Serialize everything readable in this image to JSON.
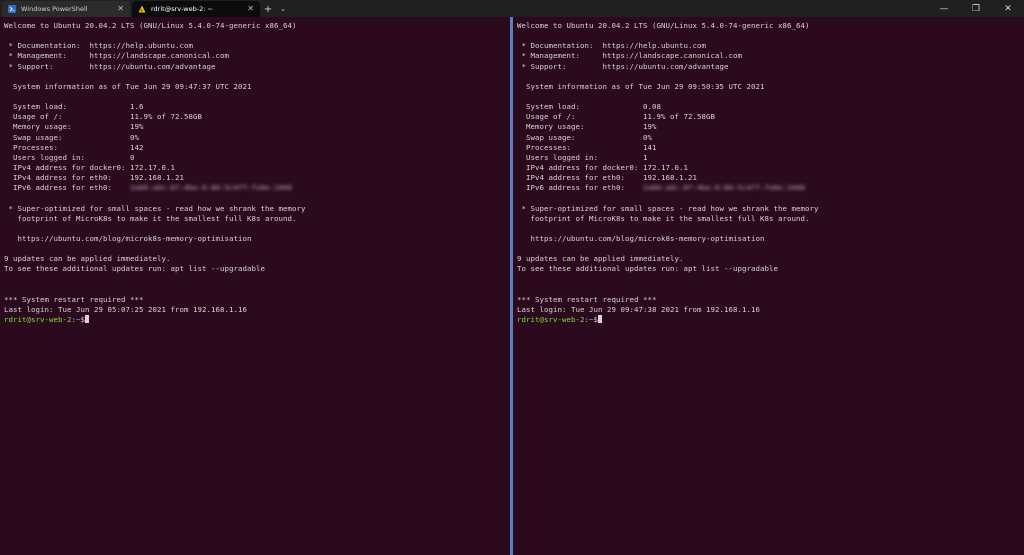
{
  "tabs": [
    {
      "title": "Windows PowerShell",
      "icon": "powershell-icon"
    },
    {
      "title": "rdrit@srv-web-2: ~",
      "icon": "ubuntu-icon"
    }
  ],
  "titlebar": {
    "new_tab": "+",
    "dropdown": "⌄",
    "minimize": "—",
    "maximize": "❐",
    "close": "✕"
  },
  "colors": {
    "background": "#2c0a1e",
    "prompt_user": "#7edc3a",
    "prompt_path": "#7fa8ff",
    "divider": "#5b7ec9"
  },
  "left": {
    "lines": [
      "Welcome to Ubuntu 20.04.2 LTS (GNU/Linux 5.4.0-74-generic x86_64)",
      "",
      " * Documentation:  https://help.ubuntu.com",
      " * Management:     https://landscape.canonical.com",
      " * Support:        https://ubuntu.com/advantage",
      "",
      "  System information as of Tue Jun 29 09:47:37 UTC 2021",
      "",
      "  System load:              1.6",
      "  Usage of /:               11.9% of 72.58GB",
      "  Memory usage:             19%",
      "  Swap usage:               0%",
      "  Processes:                142",
      "  Users logged in:          0",
      "  IPv4 address for docker0: 172.17.0.1",
      "  IPv4 address for eth0:    192.168.1.21"
    ],
    "ipv6_label": "  IPv6 address for eth0:    ",
    "lines2": [
      "",
      " * Super-optimized for small spaces - read how we shrank the memory",
      "   footprint of MicroK8s to make it the smallest full K8s around.",
      "",
      "   https://ubuntu.com/blog/microk8s-memory-optimisation",
      "",
      "9 updates can be applied immediately.",
      "To see these additional updates run: apt list --upgradable",
      "",
      "",
      "*** System restart required ***",
      "Last login: Tue Jun 29 05:07:25 2021 from 192.168.1.16"
    ],
    "prompt_user": "rdrit@srv-web-2",
    "prompt_path": "~",
    "prompt_suffix": "$"
  },
  "right": {
    "lines": [
      "Welcome to Ubuntu 20.04.2 LTS (GNU/Linux 5.4.0-74-generic x86_64)",
      "",
      " * Documentation:  https://help.ubuntu.com",
      " * Management:     https://landscape.canonical.com",
      " * Support:        https://ubuntu.com/advantage",
      "",
      "  System information as of Tue Jun 29 09:50:35 UTC 2021",
      "",
      "  System load:              0.08",
      "  Usage of /:               11.9% of 72.58GB",
      "  Memory usage:             19%",
      "  Swap usage:               0%",
      "  Processes:                141",
      "  Users logged in:          1",
      "  IPv4 address for docker0: 172.17.0.1",
      "  IPv4 address for eth0:    192.168.1.21"
    ],
    "ipv6_label": "  IPv6 address for eth0:    ",
    "lines2": [
      "",
      " * Super-optimized for small spaces - read how we shrank the memory",
      "   footprint of MicroK8s to make it the smallest full K8s around.",
      "",
      "   https://ubuntu.com/blog/microk8s-memory-optimisation",
      "",
      "9 updates can be applied immediately.",
      "To see these additional updates run: apt list --upgradable",
      "",
      "",
      "*** System restart required ***",
      "Last login: Tue Jun 29 09:47:38 2021 from 192.168.1.16"
    ],
    "prompt_user": "rdrit@srv-web-2",
    "prompt_path": "~",
    "prompt_suffix": "$"
  }
}
